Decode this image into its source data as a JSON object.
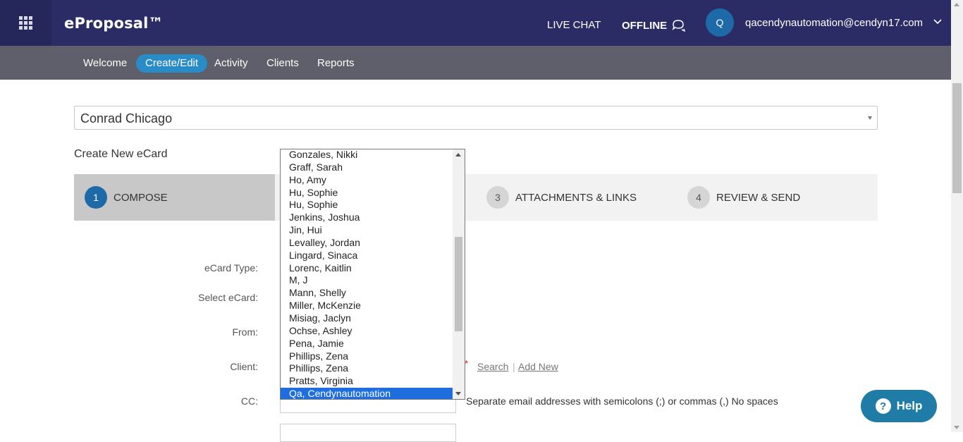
{
  "header": {
    "brand": "eProposal™",
    "live_chat": "LIVE CHAT",
    "offline": "OFFLINE",
    "avatar_initial": "Q",
    "user_email": "qacendynautomation@cendyn17.com"
  },
  "nav": {
    "items": [
      "Welcome",
      "Create/Edit",
      "Activity",
      "Clients",
      "Reports"
    ],
    "active": "Create/Edit"
  },
  "hotel_select": {
    "value": "Conrad Chicago"
  },
  "section_title": "Create New eCard",
  "steps": [
    {
      "num": "1",
      "label": "COMPOSE"
    },
    {
      "num": "3",
      "label": "ATTACHMENTS & LINKS"
    },
    {
      "num": "4",
      "label": "REVIEW & SEND"
    }
  ],
  "form": {
    "ecard_type_label": "eCard Type:",
    "select_ecard_label": "Select eCard:",
    "from_label": "From:",
    "client_label": "Client:",
    "cc_label": "CC:",
    "required_mark": "*",
    "search_link": "Search",
    "separator": "|",
    "add_new_link": "Add New",
    "cc_hint": "Separate email addresses with semicolons (;) or commas (,) No spaces"
  },
  "from_dropdown": {
    "options": [
      "Gonzales, Nikki",
      "Graff, Sarah",
      "Ho, Amy",
      "Hu, Sophie",
      "Hu, Sophie",
      "Jenkins, Joshua",
      "Jin, Hui",
      "Levalley, Jordan",
      "Lingard, Sinaca",
      "Lorenc, Kaitlin",
      "M, J",
      "Mann, Shelly",
      "Miller, McKenzie",
      "Misiag, Jaclyn",
      "Ochse, Ashley",
      "Pena, Jamie",
      "Phillips, Zena",
      "Phillips, Zena",
      "Pratts, Virginia",
      "Qa, Cendynautomation"
    ],
    "selected": "Qa, Cendynautomation"
  },
  "help": {
    "label": "Help"
  },
  "colors": {
    "topbar": "#2b2c66",
    "subnav": "#5f5e6b",
    "accent": "#2a8cc6",
    "step_active_num": "#1e6aa8",
    "help": "#1f7ca6",
    "selection": "#1e6ee0"
  }
}
